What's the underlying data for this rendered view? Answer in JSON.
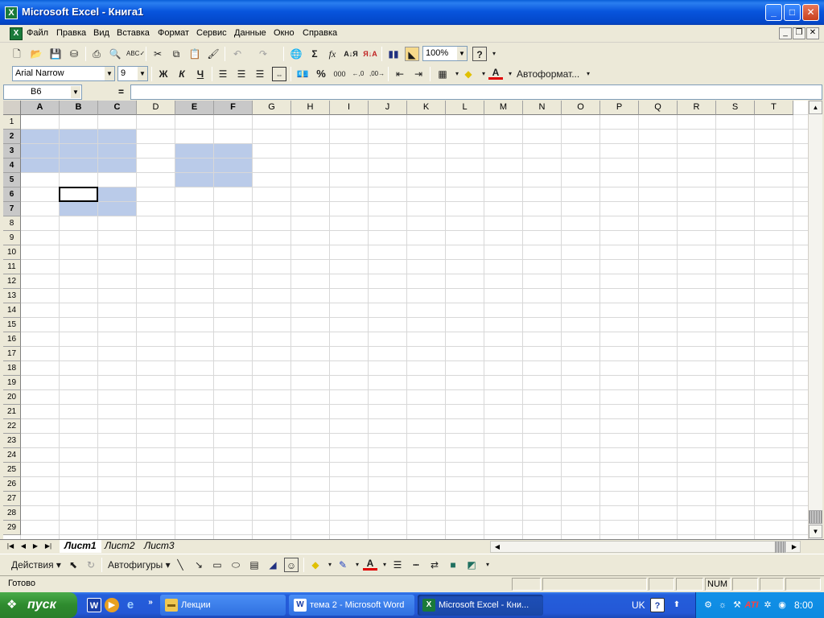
{
  "window": {
    "title": "Microsoft Excel - Книга1",
    "minimize": "_",
    "maximize": "□",
    "close": "✕"
  },
  "menu": {
    "items": [
      "Файл",
      "Правка",
      "Вид",
      "Вставка",
      "Формат",
      "Сервис",
      "Данные",
      "Окно",
      "Справка"
    ],
    "doc_controls": [
      "_",
      "❐",
      "✕"
    ]
  },
  "standard_toolbar": {
    "zoom": "100%",
    "icons": [
      "new-icon",
      "open-icon",
      "save-icon",
      "permission-icon",
      "print-icon",
      "print-preview-icon",
      "spelling-icon",
      "cut-icon",
      "copy-icon",
      "paste-icon",
      "format-painter-icon",
      "undo-icon",
      "redo-icon",
      "hyperlink-icon",
      "autosum-icon",
      "function-icon",
      "sort-ascending-icon",
      "sort-descending-icon",
      "chart-wizard-icon",
      "drawing-icon",
      "help-icon"
    ]
  },
  "formatting_toolbar": {
    "font_name": "Arial Narrow",
    "font_size": "9",
    "bold": "Ж",
    "italic": "К",
    "underline": "Ч",
    "percent": "%",
    "thousands": "000",
    "autoformat": "Автоформат..."
  },
  "formula_bar": {
    "name_box": "B6",
    "equals": "=",
    "value": ""
  },
  "grid": {
    "columns": [
      "A",
      "B",
      "C",
      "D",
      "E",
      "F",
      "G",
      "H",
      "I",
      "J",
      "K",
      "L",
      "M",
      "N",
      "O",
      "P",
      "Q",
      "R",
      "S",
      "T"
    ],
    "rows": [
      "1",
      "2",
      "3",
      "4",
      "5",
      "6",
      "7",
      "8",
      "9",
      "10",
      "11",
      "12",
      "13",
      "14",
      "15",
      "16",
      "17",
      "18",
      "19",
      "20",
      "21",
      "22",
      "23",
      "24",
      "25",
      "26",
      "27",
      "28",
      "29"
    ],
    "active_cell": "B6",
    "selected_ranges": [
      "A2:C4",
      "E3:F5",
      "B6:C7"
    ],
    "selection_color": "#b6c8e8"
  },
  "sheets": {
    "tabs": [
      "Лист1",
      "Лист2",
      "Лист3"
    ],
    "active": "Лист1"
  },
  "drawing_toolbar": {
    "actions": "Действия",
    "autoshapes": "Автофигуры"
  },
  "status_bar": {
    "ready": "Готово",
    "num": "NUM"
  },
  "taskbar": {
    "start": "пуск",
    "buttons": [
      {
        "label": "Лекции",
        "icon": "folder-icon"
      },
      {
        "label": "тема 2 - Microsoft Word",
        "icon": "word-icon"
      },
      {
        "label": "Microsoft Excel - Кни...",
        "icon": "excel-icon"
      }
    ],
    "language": "UK",
    "clock": "8:00"
  },
  "colors": {
    "title_blue": "#0855dd",
    "taskbar_blue": "#245edb",
    "start_green": "#2e8a2e",
    "chrome": "#ece9d8"
  }
}
